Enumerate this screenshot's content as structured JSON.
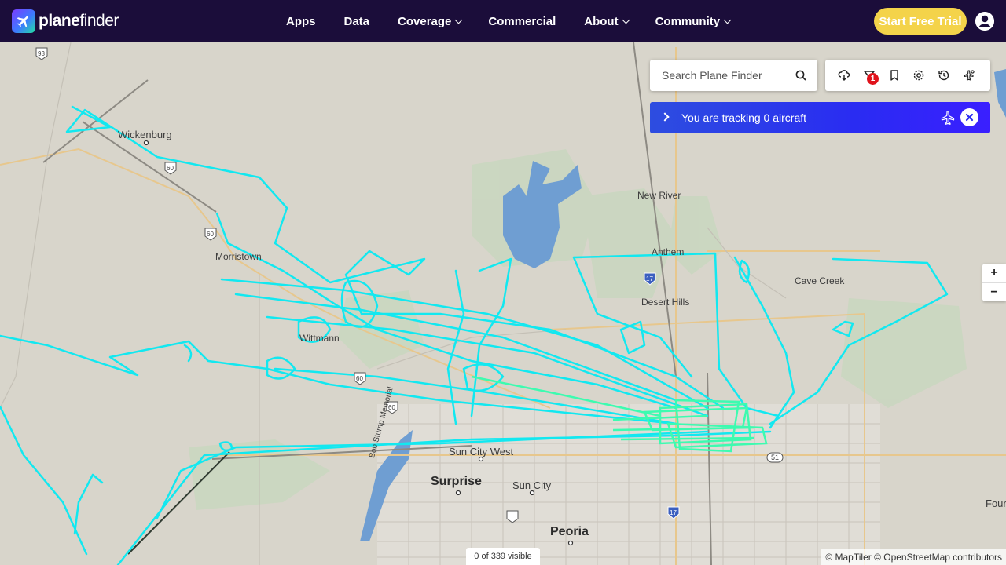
{
  "brand": {
    "name_bold": "plane",
    "name_thin": "finder"
  },
  "nav": {
    "apps": "Apps",
    "data": "Data",
    "coverage": "Coverage",
    "commercial": "Commercial",
    "about": "About",
    "community": "Community"
  },
  "cta": {
    "start_trial": "Start Free Trial"
  },
  "search": {
    "placeholder": "Search Plane Finder"
  },
  "toolbar": {
    "filter_badge": "1"
  },
  "tracking": {
    "text": "You are tracking 0 aircraft"
  },
  "zoom": {
    "in": "+",
    "out": "−"
  },
  "map": {
    "visible_count": "0 of 339 visible",
    "attribution": "© MapTiler © OpenStreetMap contributors",
    "places": {
      "wickenburg": "Wickenburg",
      "morristown": "Morristown",
      "wittmann": "Wittmann",
      "new_river": "New River",
      "anthem": "Anthem",
      "desert_hills": "Desert Hills",
      "cave_creek": "Cave Creek",
      "surprise": "Surprise",
      "sun_city_west": "Sun City West",
      "sun_city": "Sun City",
      "peoria": "Peoria",
      "fountain": "Four",
      "bob_stump": "Bob Stump Memorial"
    },
    "shields": {
      "us93": "93",
      "us60a": "60",
      "us60b": "60",
      "us60c": "60",
      "us60d": "60",
      "i17a": "17",
      "i17b": "17",
      "az51": "51"
    }
  },
  "colors": {
    "header_bg": "#1b0d3a",
    "trial_button": "#f4d34a",
    "track_primary": "#12e8f0",
    "track_dense": "#3dfbb0",
    "tracking_bar": "#2a2cf2"
  }
}
